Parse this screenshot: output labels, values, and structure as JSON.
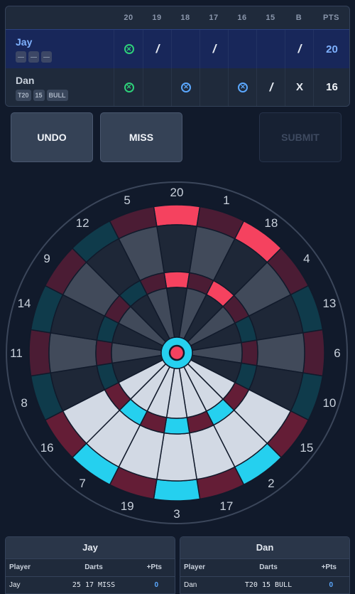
{
  "scoreboard": {
    "columns": [
      "20",
      "19",
      "18",
      "17",
      "16",
      "15",
      "B",
      "PTS"
    ],
    "players": [
      {
        "name": "Jay",
        "active": true,
        "darts": [
          "—",
          "—",
          "—"
        ],
        "marks": [
          "closed",
          "/",
          "",
          "/",
          "",
          "",
          "/"
        ],
        "points": "20"
      },
      {
        "name": "Dan",
        "active": false,
        "darts": [
          "T20",
          "15",
          "BULL"
        ],
        "marks": [
          "closed",
          "",
          "closed-blue",
          "",
          "closed-blue",
          "/",
          "X"
        ],
        "points": "16"
      }
    ]
  },
  "buttons": {
    "undo": "UNDO",
    "miss": "MISS",
    "submit": "SUBMIT"
  },
  "dartboard": {
    "numbers": [
      20,
      1,
      18,
      4,
      13,
      6,
      10,
      15,
      2,
      17,
      3,
      19,
      7,
      16,
      8,
      11,
      14,
      9,
      12,
      5
    ],
    "highlighted": {
      "double_hit": [
        20,
        18
      ],
      "triple_hit": [
        20,
        18
      ],
      "selected_segments": [
        16,
        7,
        19,
        3,
        17,
        2,
        15
      ]
    },
    "colors": {
      "background": "#111a2b",
      "segment_dark": "#1e2737",
      "segment_light": "#414a5a",
      "ring_dark": "#0f3b4b",
      "ring_light": "#4b1c34",
      "hit": "#f5425f",
      "selected_single": "#d2d9e4",
      "selected_ring": "#25d0ef",
      "selected_ring_dark": "#641d36",
      "bull_outer": "#25d0ef",
      "bull_inner": "#f5425f"
    }
  },
  "summaries": [
    {
      "title": "Jay",
      "headers": {
        "player": "Player",
        "darts": "Darts",
        "pts": "+Pts"
      },
      "row": {
        "player": "Jay",
        "darts": "25 17 MISS",
        "pts": "0"
      }
    },
    {
      "title": "Dan",
      "headers": {
        "player": "Player",
        "darts": "Darts",
        "pts": "+Pts"
      },
      "row": {
        "player": "Dan",
        "darts": "T20 15 BULL",
        "pts": "0"
      }
    }
  ]
}
